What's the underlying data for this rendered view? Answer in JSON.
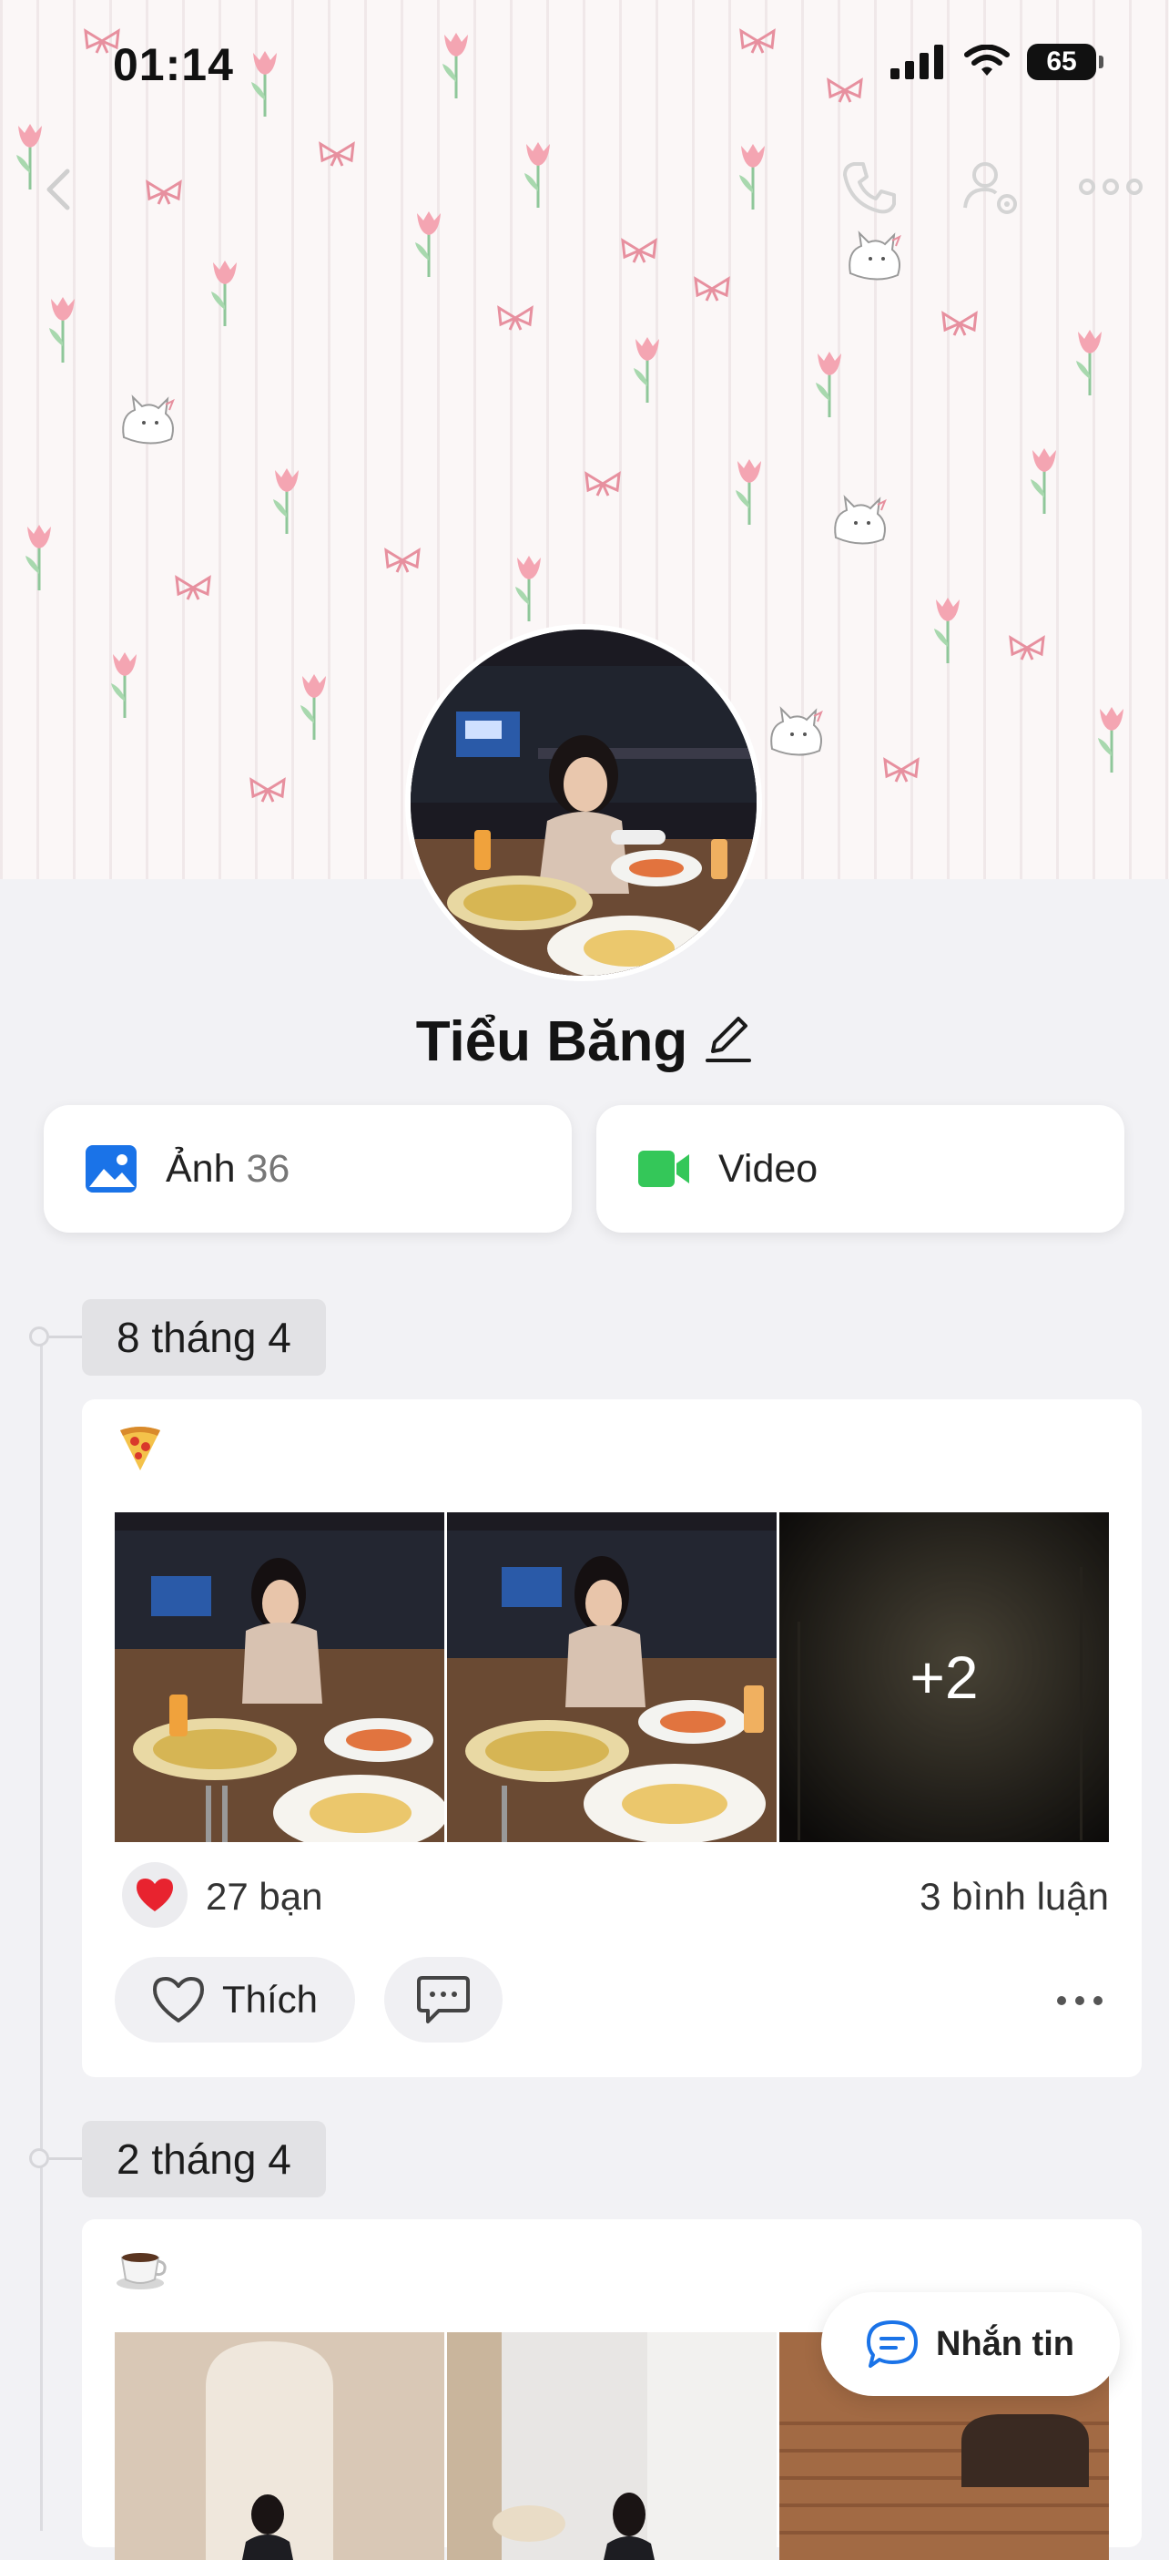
{
  "status_bar": {
    "time": "01:14",
    "battery": "65"
  },
  "profile": {
    "name": "Tiểu Băng"
  },
  "media_buttons": [
    {
      "label": "Ảnh",
      "count": "36",
      "icon": "photo-icon"
    },
    {
      "label": "Video",
      "icon": "video-icon"
    }
  ],
  "posts": [
    {
      "date": "8 tháng 4",
      "emoji": "🍕",
      "more_photos": "+2",
      "reactions": "27 bạn",
      "comments": "3 bình luận",
      "like_label": "Thích"
    },
    {
      "date": "2 tháng 4",
      "emoji": "☕"
    }
  ],
  "message_button": {
    "label": "Nhắn tin"
  },
  "colors": {
    "accent_blue": "#1a73e8",
    "video_green": "#34c759",
    "heart_red": "#e8232f"
  }
}
